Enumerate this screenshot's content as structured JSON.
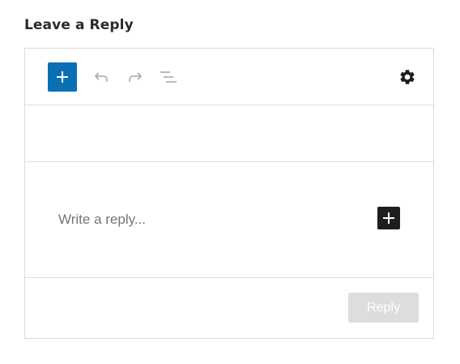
{
  "heading": "Leave a Reply",
  "toolbar": {
    "icons": {
      "add": "plus-icon",
      "undo": "undo-icon",
      "redo": "redo-icon",
      "outline": "list-view-icon",
      "settings": "gear-icon"
    }
  },
  "editor": {
    "placeholder": "Write a reply...",
    "inline_add_icon": "plus-icon"
  },
  "footer": {
    "reply_label": "Reply"
  },
  "colors": {
    "accent": "#0a70b3",
    "inline_add": "#1e1e1e",
    "disabled_button": "#dddddd",
    "border": "#dcdcde",
    "placeholder_text": "#757575"
  }
}
